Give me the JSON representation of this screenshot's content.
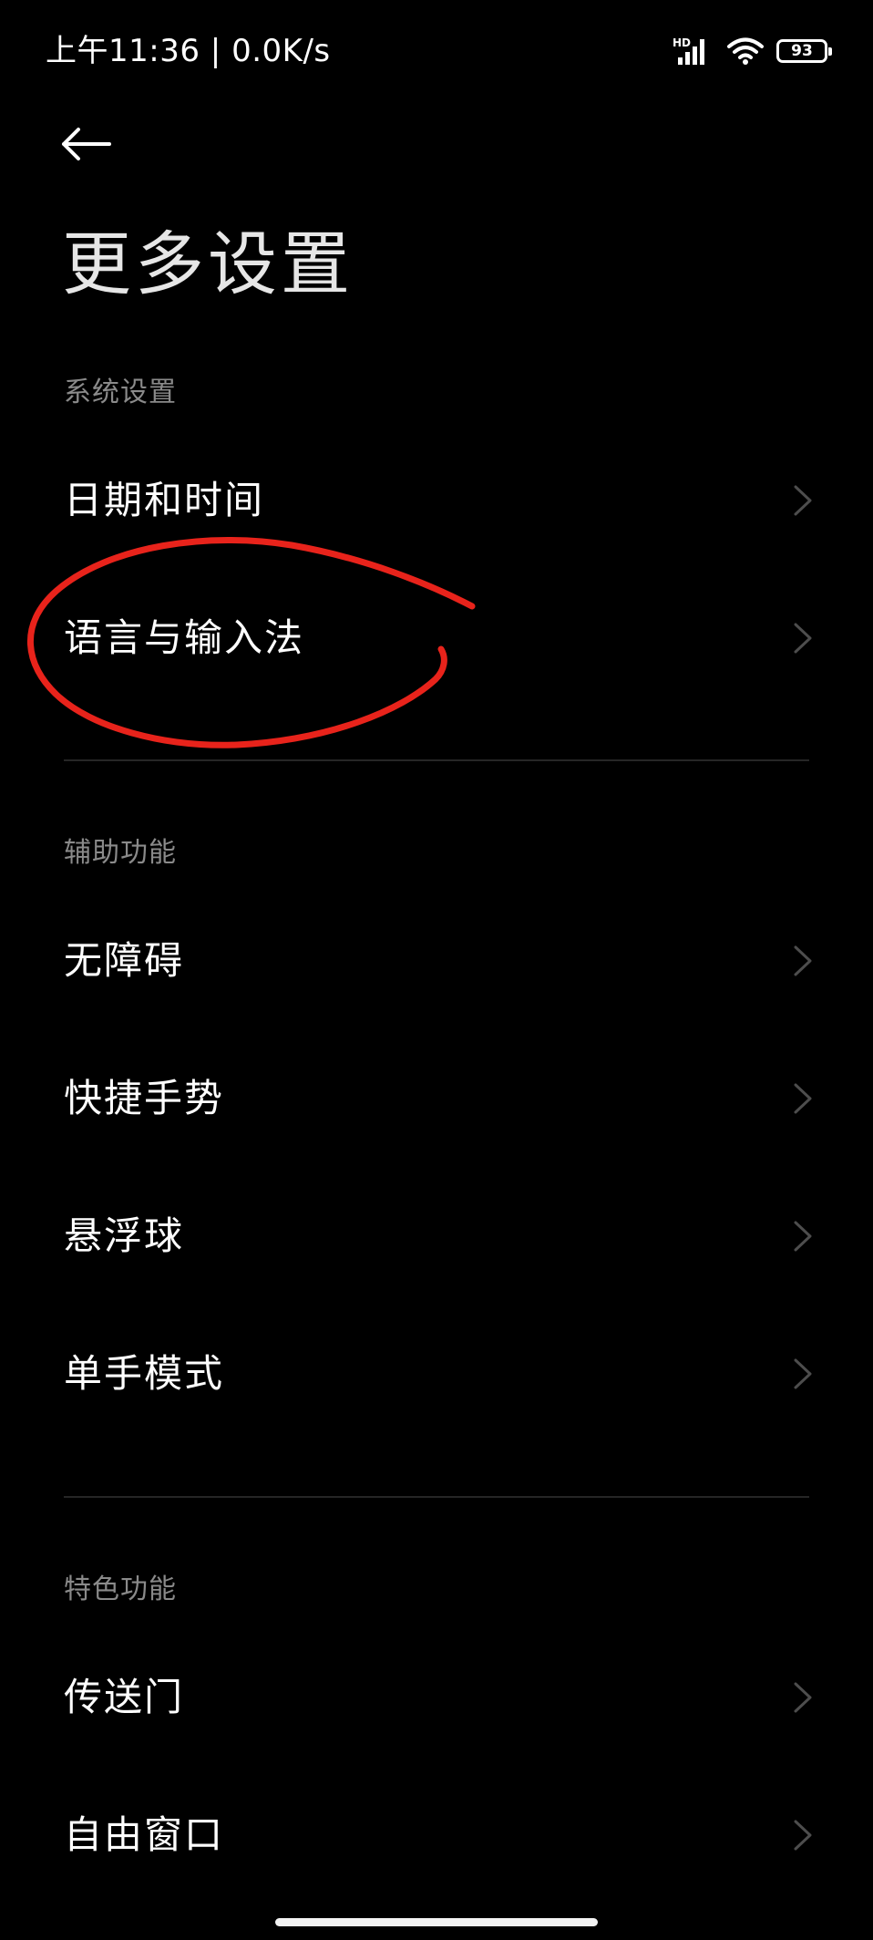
{
  "status_bar": {
    "time": "上午11:36",
    "separator": "|",
    "network_speed": "0.0K/s",
    "signal_label": "HD",
    "battery_level": "93",
    "icons": [
      "hd-signal-icon",
      "wifi-icon",
      "battery-icon"
    ]
  },
  "header": {
    "back_icon": "back-arrow-icon",
    "title": "更多设置"
  },
  "sections": [
    {
      "header": "系统设置",
      "items": [
        {
          "label": "日期和时间"
        },
        {
          "label": "语言与输入法",
          "annotated": true
        }
      ]
    },
    {
      "header": "辅助功能",
      "items": [
        {
          "label": "无障碍"
        },
        {
          "label": "快捷手势"
        },
        {
          "label": "悬浮球"
        },
        {
          "label": "单手模式"
        }
      ]
    },
    {
      "header": "特色功能",
      "items": [
        {
          "label": "传送门"
        },
        {
          "label": "自由窗口"
        }
      ]
    }
  ],
  "colors": {
    "background": "#000000",
    "text": "#ffffff",
    "section_header": "#8a8a8a",
    "chevron": "#4d4d4d",
    "annotation": "#e8231b"
  }
}
